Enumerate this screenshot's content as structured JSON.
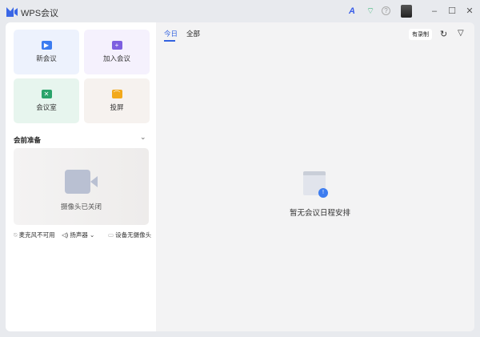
{
  "app": {
    "title": "WPS会议"
  },
  "titlebar": {
    "minimize": "–",
    "maximize": "☐",
    "close": "✕",
    "help": "?",
    "speed": "A",
    "wifi": "⌔"
  },
  "tiles": [
    {
      "label": "新会议",
      "icon": "▶",
      "bg": "#edf2fd",
      "color": "#3c7cf0"
    },
    {
      "label": "加入会议",
      "icon": "+",
      "bg": "#f5f1fd",
      "color": "#7d5fe0"
    },
    {
      "label": "会议室",
      "icon": "✕",
      "bg": "#e7f5ee",
      "color": "#2aa36a"
    },
    {
      "label": "投屏",
      "icon": "⌒",
      "bg": "#f6f2ef",
      "color": "#f2a91b"
    }
  ],
  "prep": {
    "title": "会前准备",
    "camera_off": "摄像头已关闭",
    "mic": "麦克风不可用",
    "speaker": "扬声器",
    "no_camera": "设备无摄像头"
  },
  "main": {
    "tabs": [
      "今日",
      "全部"
    ],
    "recording": "有录制",
    "empty": "暂无会议日程安排"
  }
}
